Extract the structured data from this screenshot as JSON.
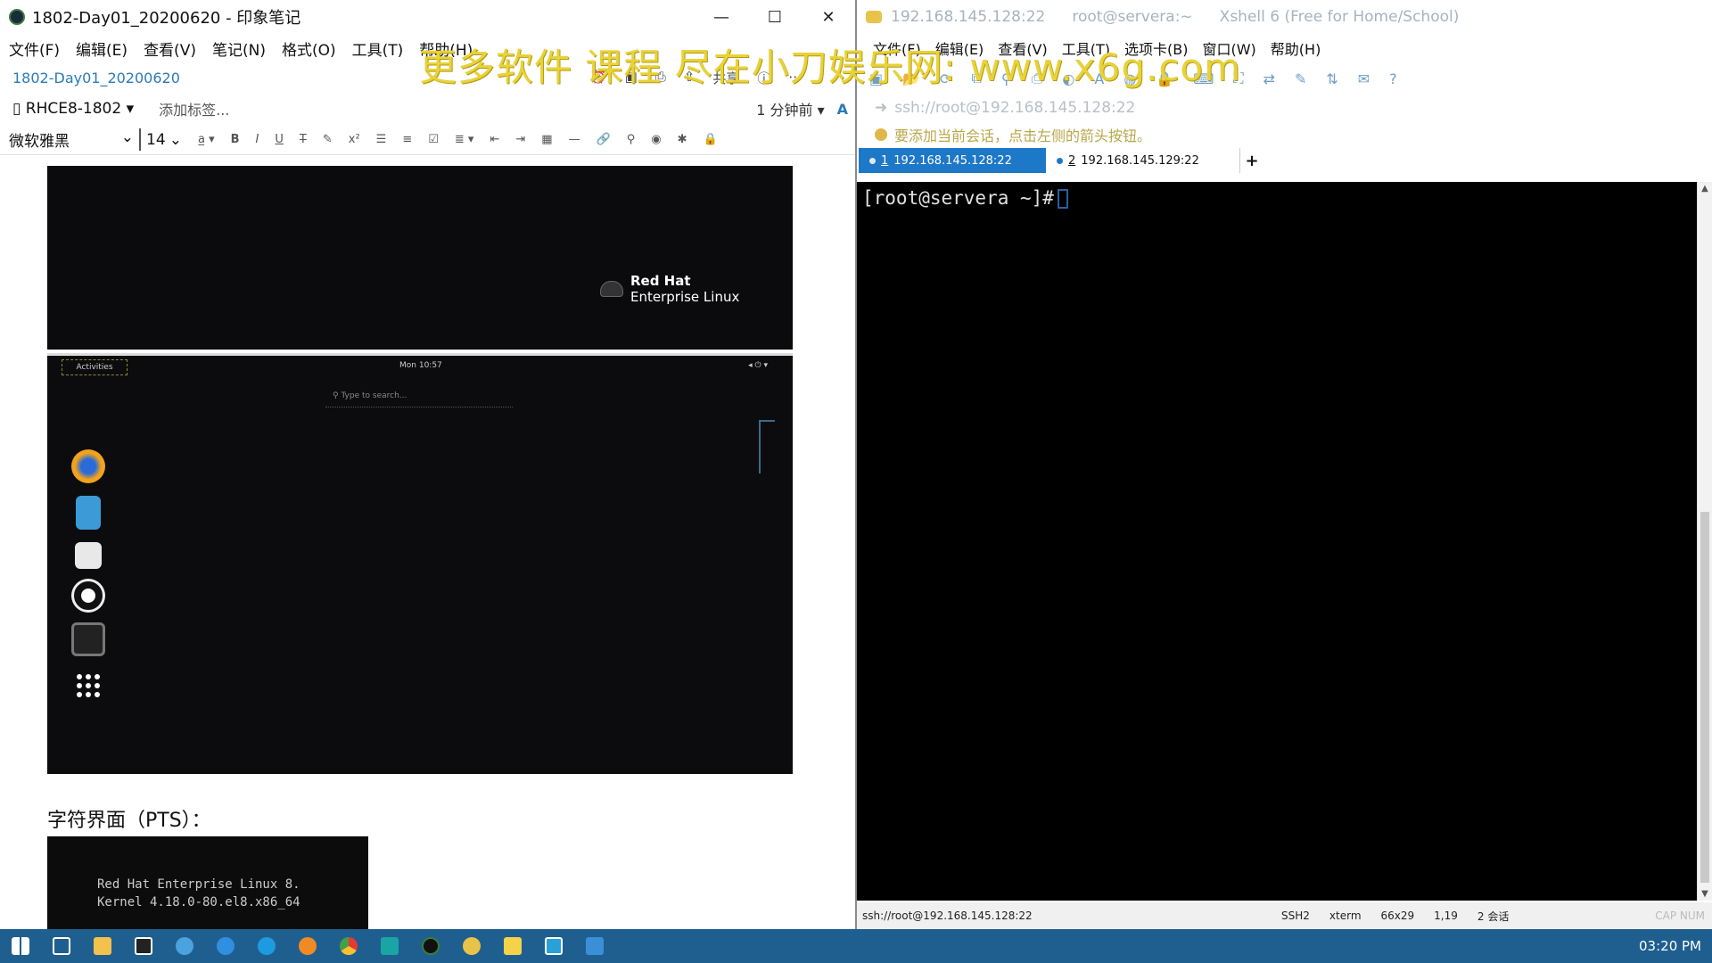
{
  "evernote": {
    "title": "1802-Day01_20200620 - 印象笔记",
    "menu": [
      "文件(F)",
      "编辑(E)",
      "查看(V)",
      "笔记(N)",
      "格式(O)",
      "工具(T)",
      "帮助(H)"
    ],
    "note_title": "1802-Day01_20200620",
    "share_label": "共享",
    "notebook": "RHCE8-1802",
    "add_tag": "添加标签...",
    "updated": "1 分钟前",
    "font_name": "微软雅黑",
    "font_size": "14",
    "rh_brand_1": "Red Hat",
    "rh_brand_2": "Enterprise Linux",
    "gnome_activities": "Activities",
    "gnome_clock": "Mon 10:57",
    "gnome_search": "Type to search...",
    "pts_heading": "字符界面（PTS）：",
    "console_line1": "Red Hat Enterprise Linux 8.",
    "console_line2": "Kernel 4.18.0-80.el8.x86_64"
  },
  "xshell": {
    "title_addr": "192.168.145.128:22",
    "title_user": "root@servera:~",
    "title_app": "Xshell 6 (Free for Home/School)",
    "menu": [
      "文件(F)",
      "编辑(E)",
      "查看(V)",
      "工具(T)",
      "选项卡(B)",
      "窗口(W)",
      "帮助(H)"
    ],
    "address": "ssh://root@192.168.145.128:22",
    "hint": "要添加当前会话，点击左侧的箭头按钮。",
    "tabs": [
      {
        "num": "1",
        "label": "192.168.145.128:22"
      },
      {
        "num": "2",
        "label": "192.168.145.129:22"
      }
    ],
    "add_tab": "+",
    "prompt": "[root@servera ~]#",
    "status": {
      "addr": "ssh://root@192.168.145.128:22",
      "proto": "SSH2",
      "term": "xterm",
      "size": "66x29",
      "pos": "1,19",
      "sessions": "2 会话",
      "caps": "CAP NUM"
    }
  },
  "watermark": "更多软件 课程 尽在小刀娱乐网: www.x6g.com",
  "taskbar": {
    "clock": "03:20 PM"
  },
  "colors": {
    "tab_active": "#1e78c8",
    "taskbar": "#1f5f8f",
    "evernote_link": "#2b7bb9",
    "watermark": "#e8d23a"
  }
}
